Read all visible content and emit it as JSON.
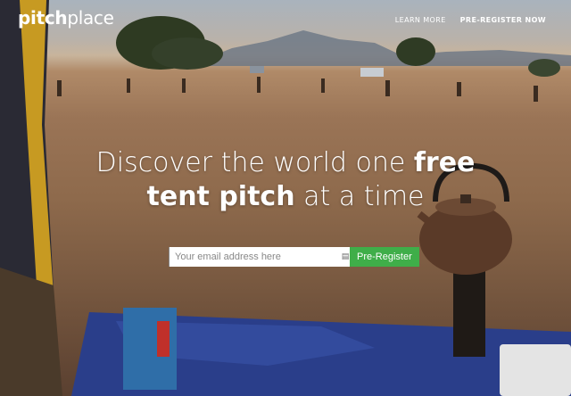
{
  "brand": {
    "logo_bold": "pitch",
    "logo_light": "place"
  },
  "nav": {
    "learn_more": "LEARN MORE",
    "pre_register": "PRE-REGISTER NOW"
  },
  "hero": {
    "line1_pre": "Discover the world one ",
    "line1_bold": "free",
    "line2_bold": "tent pitch",
    "line2_post": " at a time"
  },
  "signup": {
    "email_placeholder": "Your email address here",
    "email_value": "",
    "button_label": "Pre-Register",
    "button_color": "#3fae49"
  },
  "icons": {
    "email_field_icon": "contact-card-icon"
  }
}
